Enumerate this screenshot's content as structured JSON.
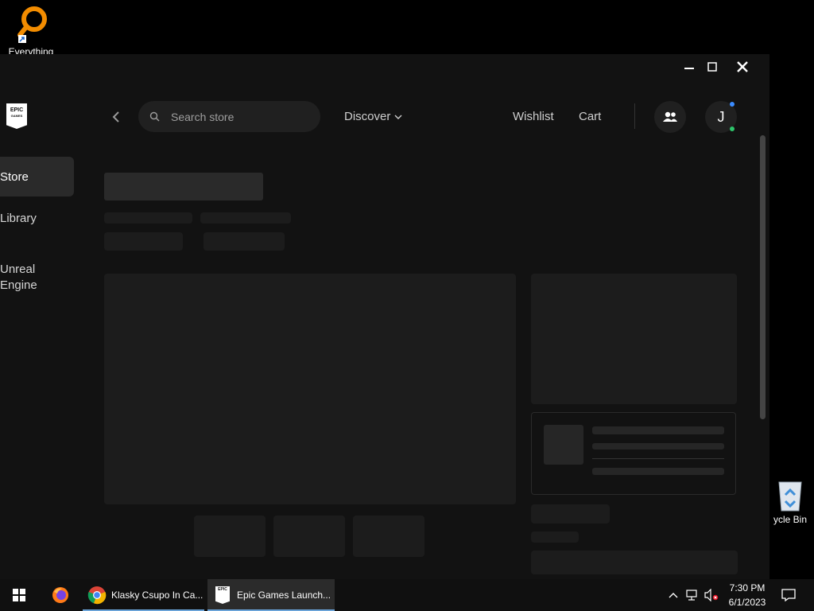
{
  "desktop": {
    "everything_label": "Everything",
    "recycle_label": "ycle Bin"
  },
  "app": {
    "logo_text_top": "EPIC",
    "logo_text_bottom": "GAMES",
    "sidebar": {
      "items": [
        {
          "label": "Store"
        },
        {
          "label": "Library"
        },
        {
          "label": "Unreal\nEngine"
        }
      ]
    },
    "search": {
      "placeholder": "Search store"
    },
    "nav": {
      "discover_label": "Discover",
      "wishlist_label": "Wishlist",
      "cart_label": "Cart"
    },
    "profile": {
      "initial": "J"
    },
    "colors": {
      "bg": "#121212",
      "accent_blue": "#3b8cff",
      "accent_green": "#2ec46b"
    }
  },
  "taskbar": {
    "tasks": [
      {
        "label": "Klasky Csupo In Ca..."
      },
      {
        "label": "Epic Games Launch..."
      }
    ],
    "clock": {
      "time": "7:30 PM",
      "date": "6/1/2023"
    }
  }
}
